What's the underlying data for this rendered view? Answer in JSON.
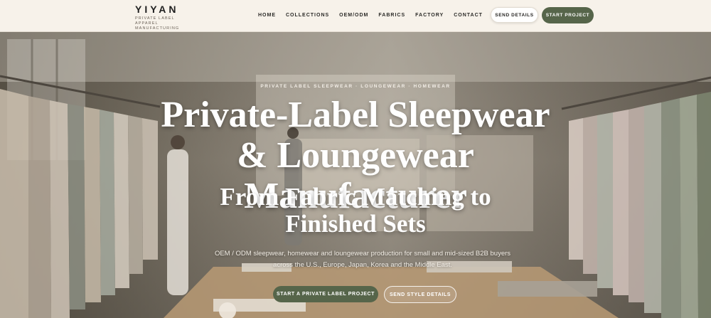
{
  "brand": {
    "name": "YIYAN",
    "tagline": "PRIVATE LABEL APPAREL MANUFACTURING"
  },
  "nav": {
    "items": [
      {
        "label": "HOME"
      },
      {
        "label": "COLLECTIONS"
      },
      {
        "label": "OEM/ODM"
      },
      {
        "label": "FABRICS"
      },
      {
        "label": "FACTORY"
      },
      {
        "label": "CONTACT"
      }
    ],
    "send_details_label": "SEND DETAILS",
    "start_project_label": "START PROJECT"
  },
  "hero": {
    "eyebrow": "PRIVATE LABEL SLEEPWEAR · LOUNGEWEAR · HOMEWEAR",
    "title": "Private-Label Sleepwear & Loungewear Manufacturer",
    "subtitle": "From Fabric Matching to Finished Sets",
    "description": "OEM / ODM sleepwear, homewear and loungewear production for small and mid-sized B2B buyers across the U.S., Europe, Japan, Korea and the Middle East.",
    "primary_cta": "START A PRIVATE LABEL PROJECT",
    "secondary_cta": "SEND STYLE DETAILS"
  },
  "colors": {
    "accent": "#56654a",
    "header_bg": "#f7f2ea",
    "text_dark": "#1f1f1f"
  }
}
